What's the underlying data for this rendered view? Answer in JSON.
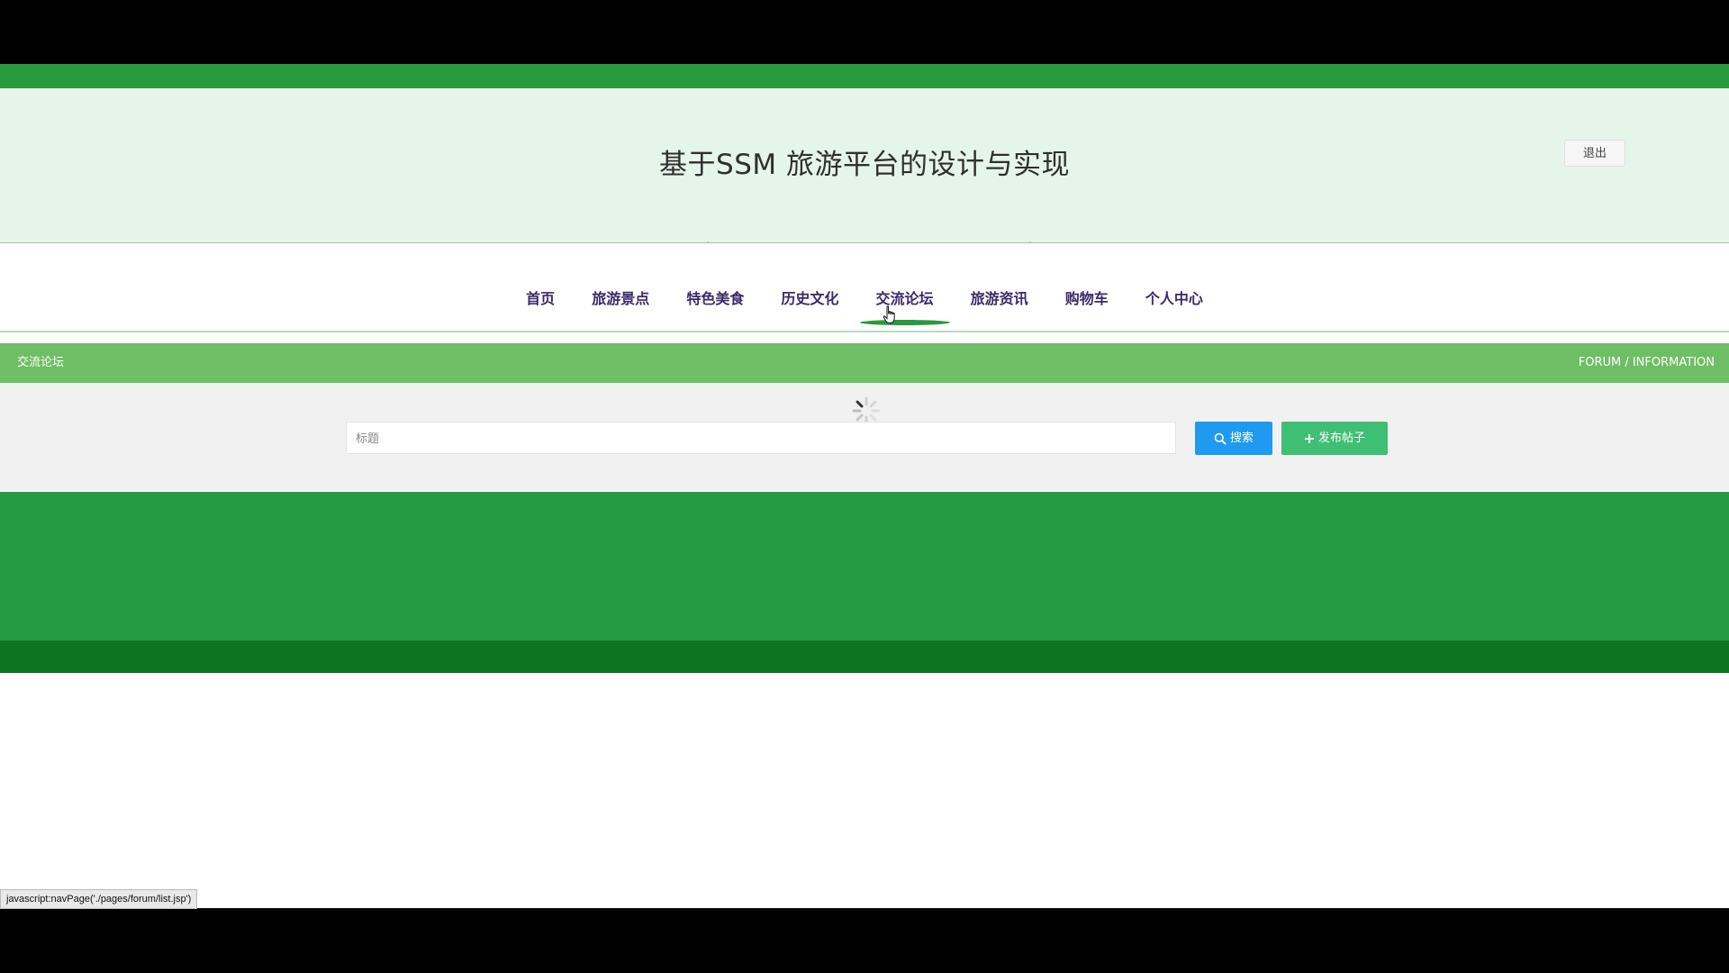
{
  "header": {
    "title": "基于SSM 旅游平台的设计与实现",
    "logout_label": "退出"
  },
  "nav": {
    "items": [
      {
        "label": "首页"
      },
      {
        "label": "旅游景点"
      },
      {
        "label": "特色美食"
      },
      {
        "label": "历史文化"
      },
      {
        "label": "交流论坛"
      },
      {
        "label": "旅游资讯"
      },
      {
        "label": "购物车"
      },
      {
        "label": "个人中心"
      }
    ],
    "active": "交流论坛"
  },
  "section": {
    "title": "交流论坛",
    "subtitle": "FORUM / INFORMATION"
  },
  "search": {
    "placeholder": "标题",
    "value": "",
    "search_label": "搜索",
    "post_label": "发布帖子"
  },
  "status_bar": {
    "url": "javascript:navPage('./pages/forum/list.jsp')"
  },
  "colors": {
    "top_band": "#2a9a3f",
    "header_bg": "#e6f5ea",
    "section_bar": "#6ebe65",
    "search_button": "#1e9bf0",
    "post_button": "#3fbf74",
    "footer": "#259b42",
    "footer_dark": "#0c7520"
  },
  "icons": [
    "search-icon",
    "plus-icon",
    "loading-spinner-icon",
    "hand-cursor-icon"
  ]
}
